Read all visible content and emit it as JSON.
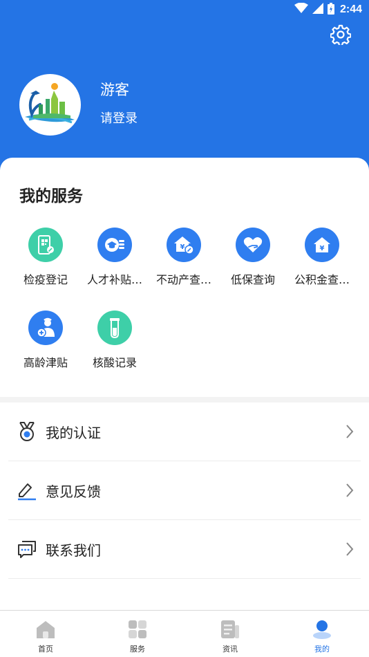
{
  "status_bar": {
    "time": "2:44"
  },
  "header": {
    "username": "游客",
    "login_text": "请登录"
  },
  "services": {
    "title": "我的服务",
    "items": [
      {
        "label": "检疫登记",
        "icon": "phone-qr-icon",
        "color": "#3ecfa8"
      },
      {
        "label": "人才补贴…",
        "icon": "graduation-coin-icon",
        "color": "#2f7ef0"
      },
      {
        "label": "不动产查…",
        "icon": "house-yen-icon",
        "color": "#2f7ef0"
      },
      {
        "label": "低保查询",
        "icon": "heart-hand-icon",
        "color": "#2f7ef0"
      },
      {
        "label": "公积金查…",
        "icon": "house-fund-icon",
        "color": "#2f7ef0"
      },
      {
        "label": "高龄津贴",
        "icon": "elder-person-icon",
        "color": "#2f7ef0"
      },
      {
        "label": "核酸记录",
        "icon": "test-tube-icon",
        "color": "#3ecfa8"
      }
    ]
  },
  "menu": [
    {
      "label": "我的认证",
      "icon": "medal-icon"
    },
    {
      "label": "意见反馈",
      "icon": "edit-icon"
    },
    {
      "label": "联系我们",
      "icon": "chat-icon"
    }
  ],
  "tabbar": {
    "tabs": [
      {
        "label": "首页",
        "icon": "home-icon"
      },
      {
        "label": "服务",
        "icon": "grid-icon"
      },
      {
        "label": "资讯",
        "icon": "news-icon"
      },
      {
        "label": "我的",
        "icon": "profile-icon"
      }
    ],
    "active_index": 3,
    "active_color": "#2474e5"
  },
  "colors": {
    "header_blue": "#2474e5",
    "green": "#3ecfa8",
    "blue": "#2f7ef0"
  }
}
